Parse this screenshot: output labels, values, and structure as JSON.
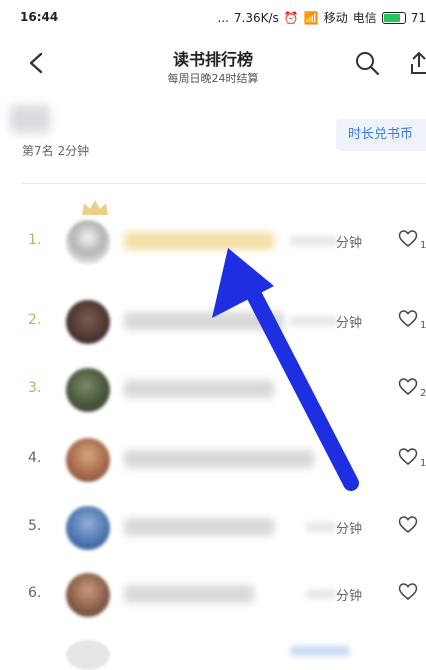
{
  "status_bar": {
    "time": "16:44",
    "dots": "...",
    "speed": "7.36K/s",
    "carrier1": "移动",
    "carrier2": "电信",
    "battery": "71"
  },
  "header": {
    "title": "读书排行榜",
    "subtitle": "每周日晚24时结算"
  },
  "my_rank": {
    "text": "第7名 2分钟",
    "exchange_button": "时长兑书币"
  },
  "list": [
    {
      "rank": "1.",
      "time_suffix": "分钟",
      "count": "1",
      "rank_color": "#c9a96e"
    },
    {
      "rank": "2.",
      "time_suffix": "分钟",
      "count": "1",
      "rank_color": "#c9a96e"
    },
    {
      "rank": "3.",
      "time_suffix": "",
      "count": "2",
      "rank_color": "#c9a96e"
    },
    {
      "rank": "4.",
      "time_suffix": "",
      "count": "1",
      "rank_color": "#666666"
    },
    {
      "rank": "5.",
      "time_suffix": "分钟",
      "count": "",
      "rank_color": "#666666"
    },
    {
      "rank": "6.",
      "time_suffix": "分钟",
      "count": "",
      "rank_color": "#666666"
    }
  ],
  "colors": {
    "accent_blue": "#3d7be0",
    "gold": "#c9a96e",
    "annotation_arrow": "#1d2fe0"
  },
  "icons": [
    "back-chevron-icon",
    "search-icon",
    "share-icon",
    "heart-icon",
    "crown-icon"
  ]
}
